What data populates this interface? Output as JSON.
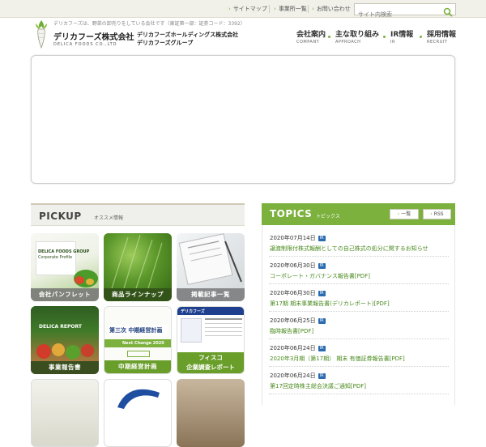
{
  "util_nav": {
    "sitemap": "サイトマップ",
    "offices": "事業所一覧",
    "contact": "お問い合わせ",
    "search_placeholder": "サイト内検索"
  },
  "header": {
    "tagline": "デリカフーズは、野菜の卸売りをしている会社です（東証第一部：証券コード：3392）",
    "company_name": "デリカフーズ株式会社",
    "company_name_en": "DELICA FOODS CO.,LTD",
    "group_line1": "デリカフーズホールディングス株式会社",
    "group_line2": "デリカフーズグループ"
  },
  "global_nav": [
    {
      "jp": "会社案内",
      "en": "COMPANY"
    },
    {
      "jp": "主な取り組み",
      "en": "APPROACH"
    },
    {
      "jp": "IR情報",
      "en": "IR"
    },
    {
      "jp": "採用情報",
      "en": "RECRUIT"
    }
  ],
  "pickup": {
    "title": "PICKUP",
    "subtitle": "オススメ情報",
    "tiles": [
      {
        "label": "会社パンフレット",
        "mini1": "DELICA FOODS GROUP",
        "mini2": "Corporate Profile"
      },
      {
        "label": "商品ラインナップ"
      },
      {
        "label": "掲載記事一覧"
      },
      {
        "label": "事業報告書",
        "mini1": "DELICA REPORT"
      },
      {
        "label": "中期経営計画",
        "mini1": "第三次 中期経営計画",
        "mini2": "Next Change 2020"
      },
      {
        "label": "フィスコ企業調査レポート",
        "label1": "フィスコ",
        "label2": "企業調査レポート",
        "mini1": "デリカフーズ"
      }
    ]
  },
  "topics": {
    "title": "TOPICS",
    "subtitle": "トピックス",
    "list_button": "一覧",
    "rss_button": "RSS",
    "badge": "IR",
    "items": [
      {
        "date": "2020年07月14日",
        "title": "譲渡制限付株式報酬としての自己株式の処分に関するお知らせ"
      },
      {
        "date": "2020年06月30日",
        "title": "コーポレート・ガバナンス報告書[PDF]"
      },
      {
        "date": "2020年06月30日",
        "title": "第17期 期末事業報告書(デリカレポート)[PDF]"
      },
      {
        "date": "2020年06月25日",
        "title": "臨時報告書[PDF]"
      },
      {
        "date": "2020年06月24日",
        "title": "2020年3月期（第17期） 期末 有価証券報告書[PDF]"
      },
      {
        "date": "2020年06月24日",
        "title": "第17回定時株主総会決議ご通知[PDF]"
      }
    ]
  },
  "colors": {
    "accent_green": "#7bb13c",
    "link_green": "#4a8a1e",
    "ir_badge_blue": "#2b6cb0"
  }
}
